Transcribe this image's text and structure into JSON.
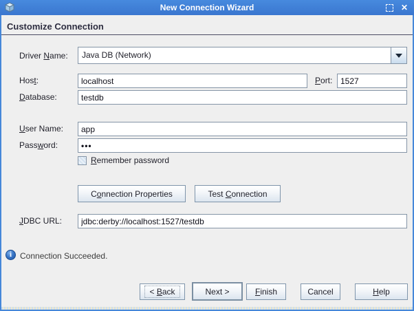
{
  "window": {
    "title": "New Connection Wizard",
    "close_glyph": "✕"
  },
  "header": {
    "title": "Customize Connection"
  },
  "form": {
    "driver": {
      "label": {
        "pre": "Driver ",
        "key": "N",
        "post": "ame:"
      },
      "value": "Java DB (Network)"
    },
    "host": {
      "label": {
        "pre": "Hos",
        "key": "t",
        "post": ":"
      },
      "value": "localhost"
    },
    "port": {
      "label": {
        "pre": "",
        "key": "P",
        "post": "ort:"
      },
      "value": "1527"
    },
    "database": {
      "label": {
        "pre": "",
        "key": "D",
        "post": "atabase:"
      },
      "value": "testdb"
    },
    "user_name": {
      "label": {
        "pre": "",
        "key": "U",
        "post": "ser Name:"
      },
      "value": "app"
    },
    "password": {
      "label": {
        "pre": "Pass",
        "key": "w",
        "post": "ord:"
      },
      "value": "•••"
    },
    "remember_password": {
      "label": {
        "pre": "",
        "key": "R",
        "post": "emember password"
      },
      "checked": false
    },
    "buttons": {
      "connection_properties": {
        "pre": "C",
        "key": "o",
        "post": "nnection Properties"
      },
      "test_connection": {
        "pre": "Test ",
        "key": "C",
        "post": "onnection"
      }
    },
    "jdbc_url": {
      "label": {
        "pre": "",
        "key": "J",
        "post": "DBC URL:"
      },
      "value": "jdbc:derby://localhost:1527/testdb"
    }
  },
  "status": {
    "message": "Connection Succeeded.",
    "info_glyph": "i"
  },
  "footer": {
    "back": {
      "pre": "< ",
      "key": "B",
      "post": "ack"
    },
    "next": {
      "pre": "",
      "key": "",
      "post": "Next >"
    },
    "finish": {
      "pre": "",
      "key": "F",
      "post": "inish"
    },
    "cancel": {
      "pre": "",
      "key": "",
      "post": "Cancel"
    },
    "help": {
      "pre": "",
      "key": "H",
      "post": "elp"
    }
  },
  "colors": {
    "titlebar": "#3d7ed9",
    "window_border": "#4687d9",
    "background": "#efefef",
    "field_border": "#8494a6",
    "info_icon": "#1d55a8"
  }
}
